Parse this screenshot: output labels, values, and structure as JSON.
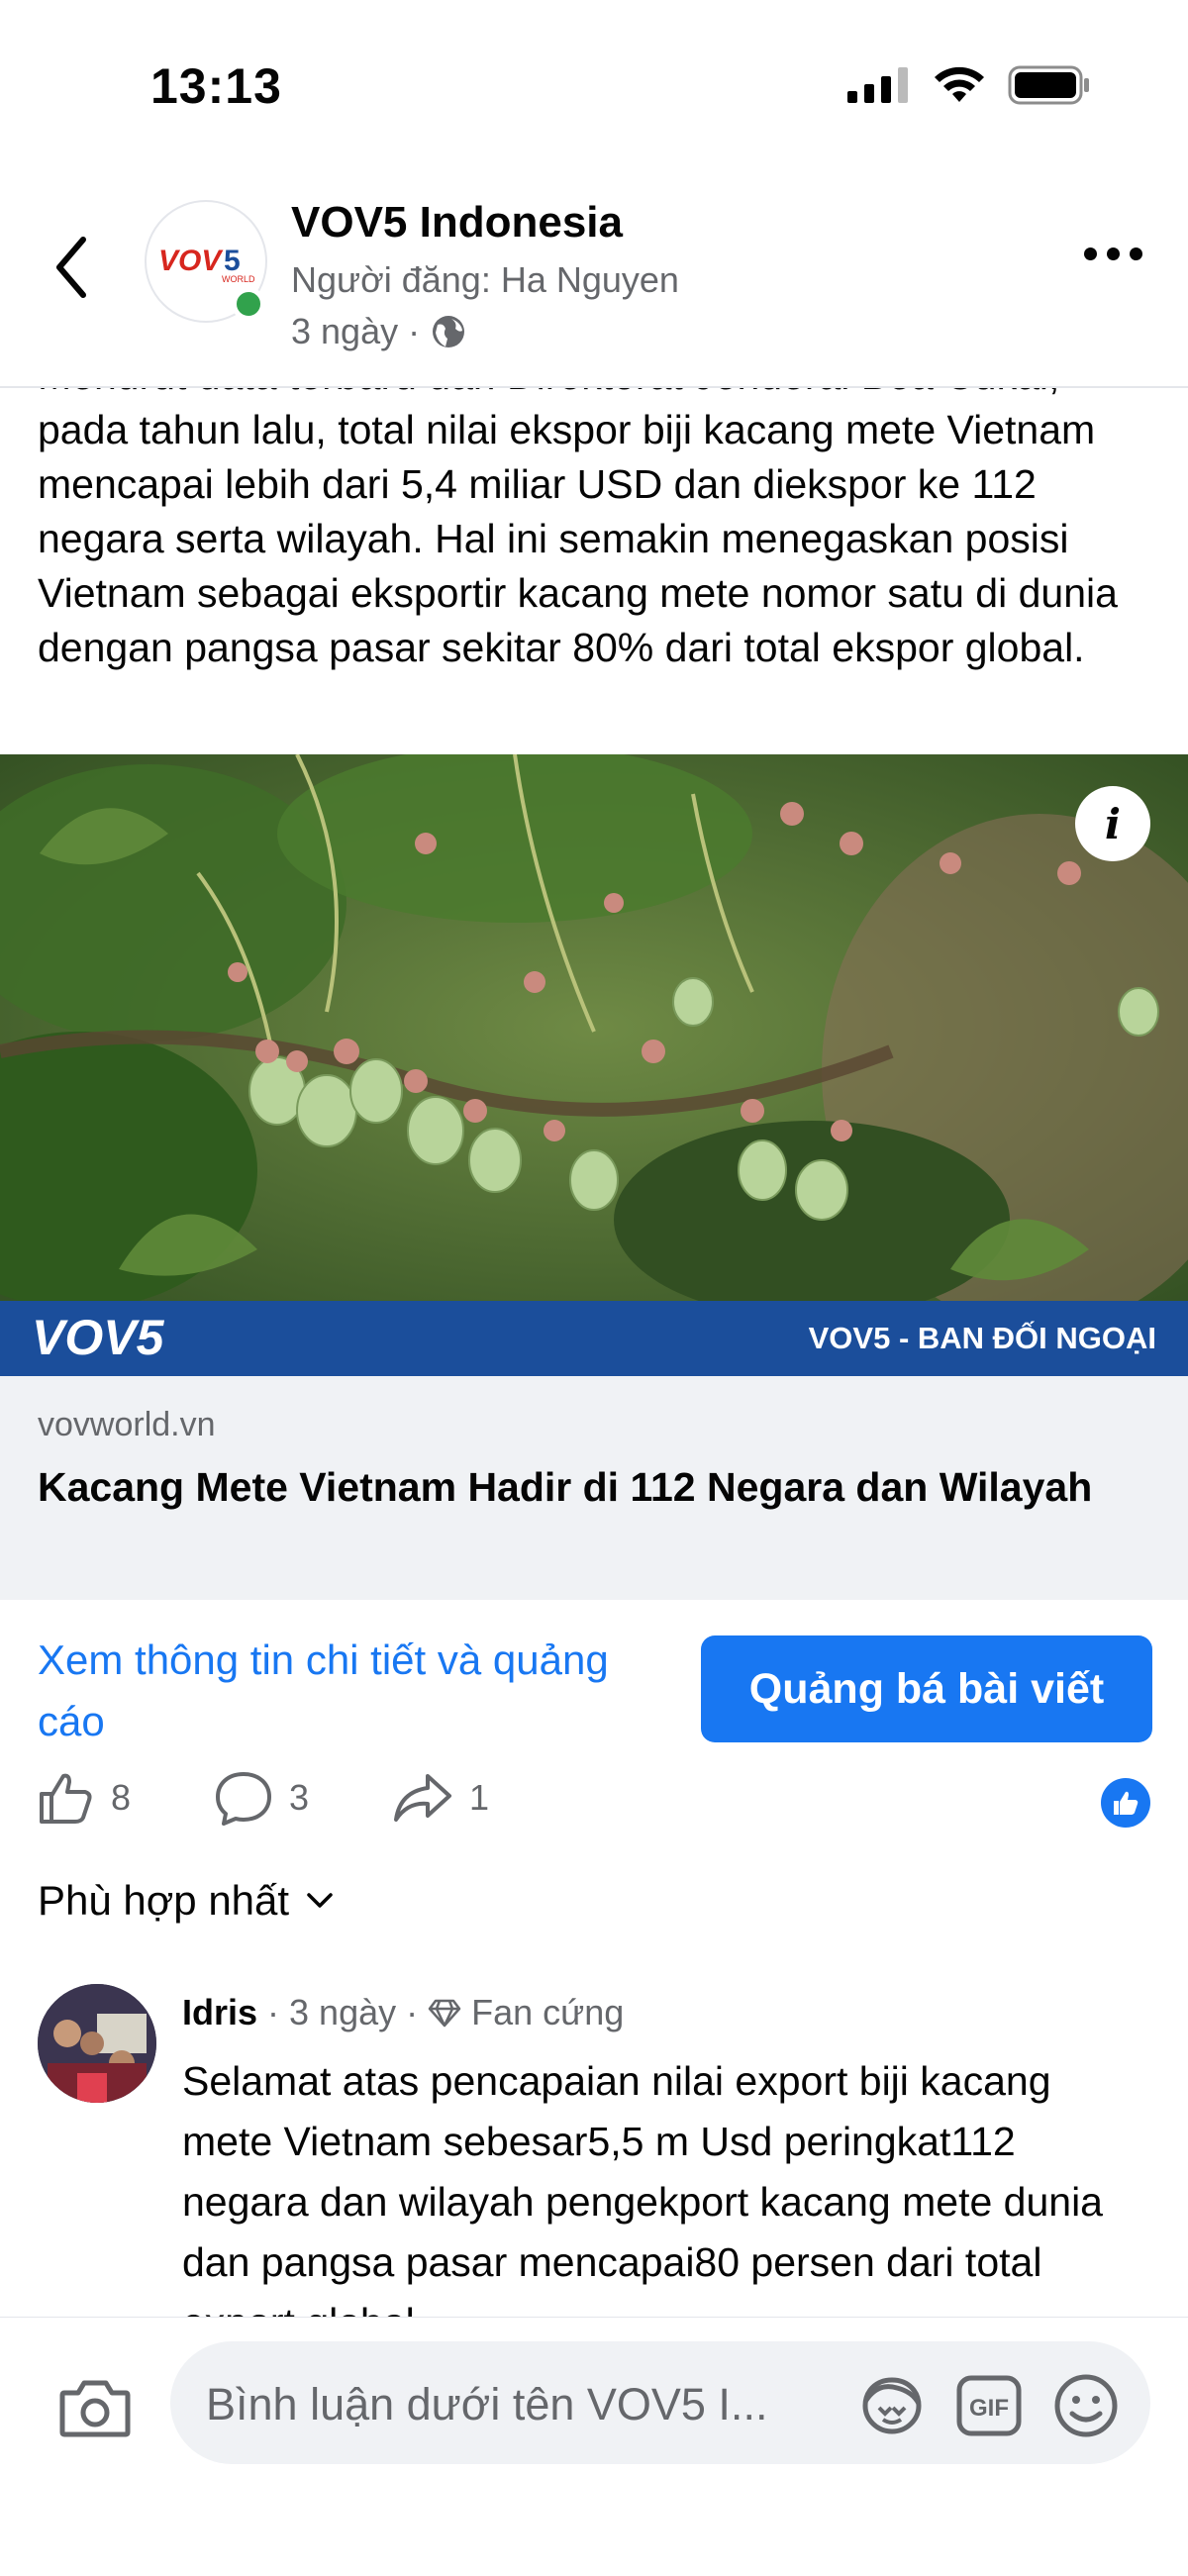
{
  "status_bar": {
    "time": "13:13"
  },
  "header": {
    "page_name": "VOV5 Indonesia",
    "posted_by": "Người đăng: Ha Nguyen",
    "post_time": "3 ngày",
    "separator": "·"
  },
  "post": {
    "text": "Menurut data terbaru dari Direktorat Jenderal Bea Cukai, pada tahun lalu, total nilai ekspor biji kacang mete Vietnam mencapai lebih dari 5,4 miliar USD dan diekspor ke 112 negara serta wilayah. Hal ini semakin menegaskan posisi Vietnam sebagai eksportir kacang mete nomor satu di dunia dengan pangsa pasar sekitar 80% dari total ekspor global."
  },
  "link": {
    "image_logo": "VOV5",
    "image_banner_right": "VOV5 - BAN ĐỐI NGOẠI",
    "info_label": "i",
    "domain": "vovworld.vn",
    "title": "Kacang Mete Vietnam Hadir di 112 Negara dan Wilayah"
  },
  "cta": {
    "details_link": "Xem thông tin chi tiết và quảng cáo",
    "boost_button": "Quảng bá bài viết"
  },
  "reactions": {
    "likes": "8",
    "comments": "3",
    "shares": "1"
  },
  "sort": {
    "label": "Phù hợp nhất"
  },
  "comment": {
    "author": "Idris",
    "time": "3 ngày",
    "badge": "Fan cứng",
    "separator": "·",
    "text": "Selamat atas pencapaian nilai export biji kacang mete Vietnam sebesar5,5 m Usd peringkat112 negara dan wilayah pengekport kacang mete dunia dan pangsa pasar mencapai80 persen dari total export global"
  },
  "composer": {
    "placeholder": "Bình luận dưới tên VOV5 I..."
  },
  "colors": {
    "accent": "#1877f2",
    "banner": "#1b4e9b",
    "online": "#31a24c",
    "muted": "#65676b"
  }
}
